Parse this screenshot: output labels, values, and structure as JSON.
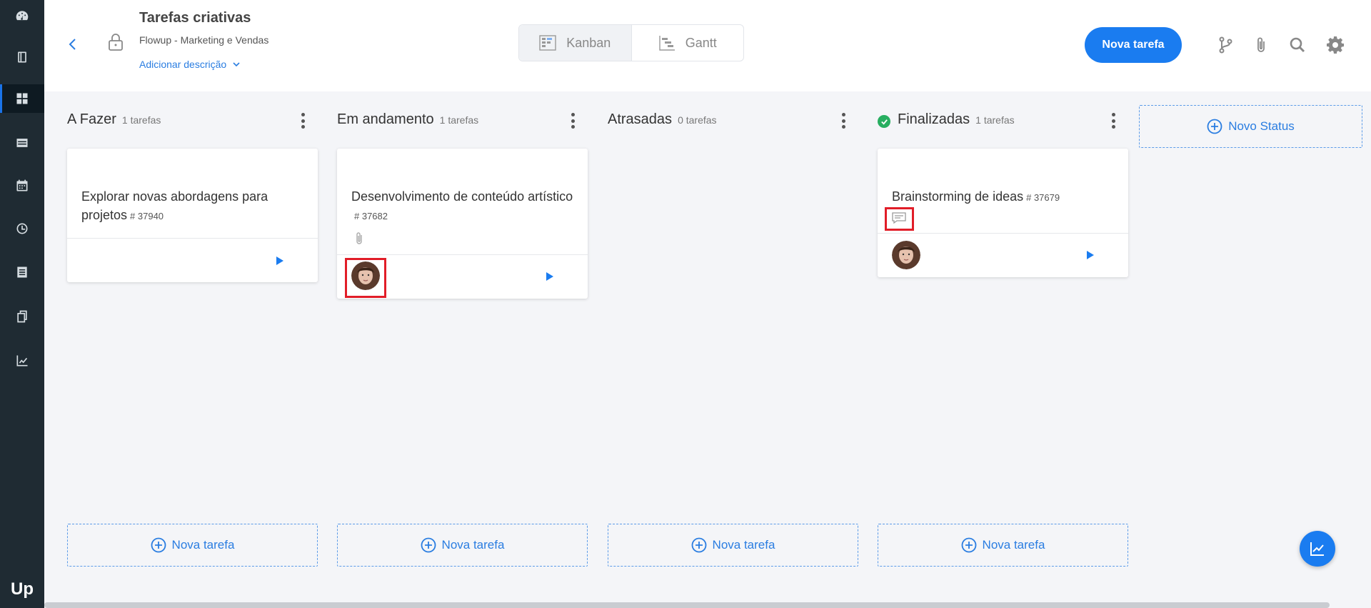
{
  "sidebar": {
    "items": [
      {
        "icon": "dashboard-icon"
      },
      {
        "icon": "book-icon"
      },
      {
        "icon": "grid-icon",
        "active": true
      },
      {
        "icon": "table-icon"
      },
      {
        "icon": "calendar-icon"
      },
      {
        "icon": "clock-icon"
      },
      {
        "icon": "list-icon"
      },
      {
        "icon": "copy-icon"
      },
      {
        "icon": "chart-icon"
      }
    ],
    "logo": "Up"
  },
  "header": {
    "title": "Tarefas criativas",
    "subtitle": "Flowup - Marketing e Vendas",
    "add_description": "Adicionar descrição",
    "views": [
      {
        "label": "Kanban",
        "active": true
      },
      {
        "label": "Gantt",
        "active": false
      }
    ],
    "new_task_label": "Nova tarefa",
    "icons": [
      "branch-icon",
      "paperclip-icon",
      "search-icon",
      "gear-icon"
    ]
  },
  "columns": [
    {
      "name": "A Fazer",
      "count": "1 tarefas",
      "cards": [
        {
          "title": "Explorar novas abordagens para projetos",
          "id": "# 37940"
        }
      ],
      "add_label": "Nova tarefa"
    },
    {
      "name": "Em andamento",
      "count": "1 tarefas",
      "cards": [
        {
          "title": "Desenvolvimento de conteúdo artístico",
          "id": "# 37682"
        }
      ],
      "add_label": "Nova tarefa"
    },
    {
      "name": "Atrasadas",
      "count": "0 tarefas",
      "cards": [],
      "add_label": "Nova tarefa"
    },
    {
      "name": "Finalizadas",
      "count": "1 tarefas",
      "cards": [
        {
          "title": "Brainstorming de ideas",
          "id": "# 37679"
        }
      ],
      "add_label": "Nova tarefa"
    }
  ],
  "new_status_label": "Novo Status",
  "colors": {
    "accent": "#1a7cf0",
    "sidebar": "#1f2b33",
    "done": "#27ae60",
    "highlight": "#e11d28"
  }
}
